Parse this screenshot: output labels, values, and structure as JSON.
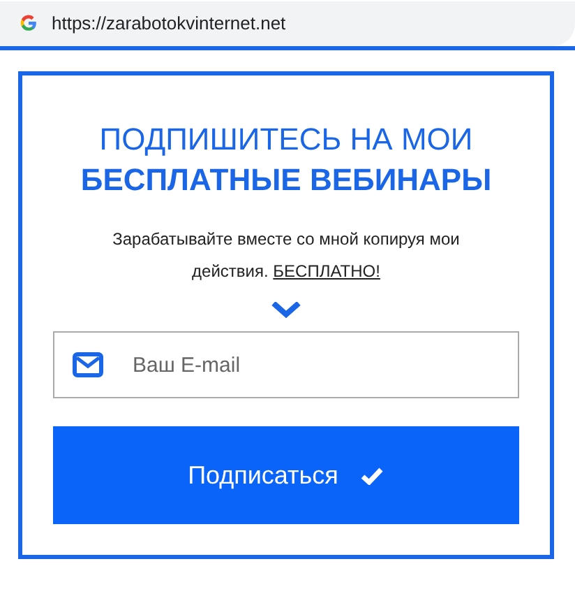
{
  "address_bar": {
    "url": "https://zarabotokvinternet.net"
  },
  "form": {
    "title_line_1": "ПОДПИШИТЕСЬ НА МОИ",
    "title_line_2": "БЕСПЛАТНЫЕ ВЕБИНАРЫ",
    "description": "Зарабатывайте вместе со мной копируя мои действия.",
    "description_link": "БЕСПЛАТНО!",
    "email_field": {
      "placeholder": "Ваш E-mail"
    },
    "submit_button": {
      "label": "Подписаться"
    }
  }
}
